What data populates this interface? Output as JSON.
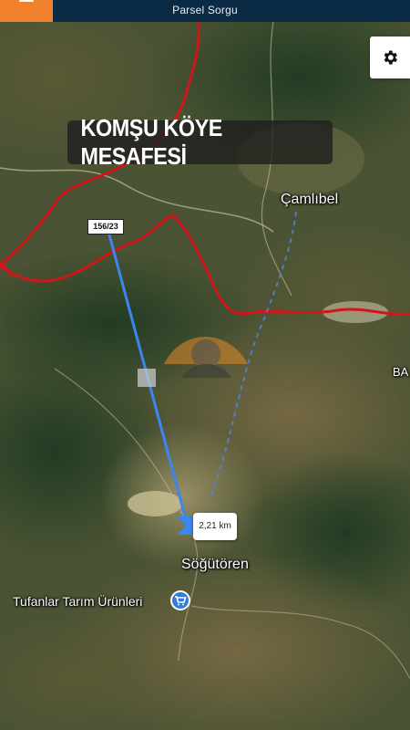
{
  "topbar": {
    "title": "Parsel Sorgu",
    "accent_color": "#f0802b",
    "bar_color": "#0b2a44"
  },
  "icons": {
    "menu": "hamburger-icon",
    "settings": "gear-icon",
    "shop": "shopping-cart-icon"
  },
  "banner": {
    "title": "KOMŞU KÖYE MESAFESİ"
  },
  "map": {
    "parcel_label": "156/23",
    "distance_label": "2,21 km",
    "places": {
      "camlibel": "Çamlıbel",
      "sogutoren": "Söğütören",
      "tufanlar": "Tufanlar Tarım Ürünleri",
      "ba": "BA"
    },
    "boundary_color": "#d0161b",
    "measure_line_color": "#3b86f0"
  }
}
